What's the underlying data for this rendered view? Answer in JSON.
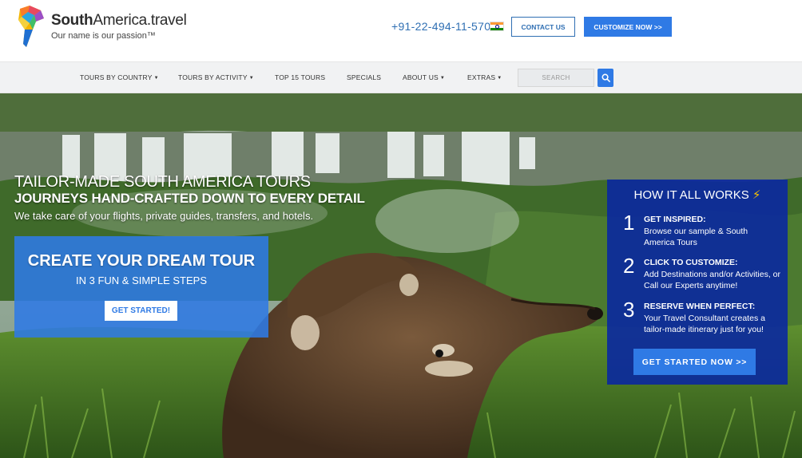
{
  "brand": {
    "name_bold": "South",
    "name_rest": "America.travel",
    "tagline": "Our name is our passion™"
  },
  "header": {
    "phone": "+91-22-494-11-570",
    "contact_label": "CONTACT US",
    "customize_label": "CUSTOMIZE NOW >>"
  },
  "nav": {
    "items": [
      {
        "label": "TOURS BY COUNTRY",
        "dropdown": true
      },
      {
        "label": "TOURS BY ACTIVITY",
        "dropdown": true
      },
      {
        "label": "TOP 15 TOURS",
        "dropdown": false
      },
      {
        "label": "SPECIALS",
        "dropdown": false
      },
      {
        "label": "ABOUT US",
        "dropdown": true
      },
      {
        "label": "EXTRAS",
        "dropdown": true
      }
    ],
    "search_placeholder": "SEARCH"
  },
  "hero": {
    "title": "TAILOR-MADE SOUTH AMERICA TOURS",
    "subtitle": "JOURNEYS HAND-CRAFTED DOWN TO EVERY DETAIL",
    "description": "We take care of your flights, private guides, transfers, and hotels."
  },
  "dream": {
    "title": "CREATE YOUR DREAM TOUR",
    "subtitle": "IN 3 FUN & SIMPLE STEPS",
    "button": "GET STARTED!"
  },
  "works": {
    "title": "HOW IT ALL WORKS",
    "steps": [
      {
        "num": "1",
        "head": "GET INSPIRED:",
        "body": "Browse our sample & South America Tours"
      },
      {
        "num": "2",
        "head": "CLICK TO CUSTOMIZE:",
        "body": "Add Destinations and/or Activities, or Call our Experts anytime!"
      },
      {
        "num": "3",
        "head": "RESERVE WHEN PERFECT:",
        "body": "Your Travel Consultant creates a tailor-made itinerary just for you!"
      }
    ],
    "button": "GET STARTED NOW >>"
  },
  "colors": {
    "accent_blue": "#2f7ae5",
    "link_blue": "#2f6fb3",
    "works_panel": "#0a28a0",
    "bolt": "#f6c100"
  },
  "icons": [
    "logo-mark",
    "india-flag-icon",
    "search-icon",
    "lightning-bolt-icon",
    "caret-down-icon"
  ]
}
